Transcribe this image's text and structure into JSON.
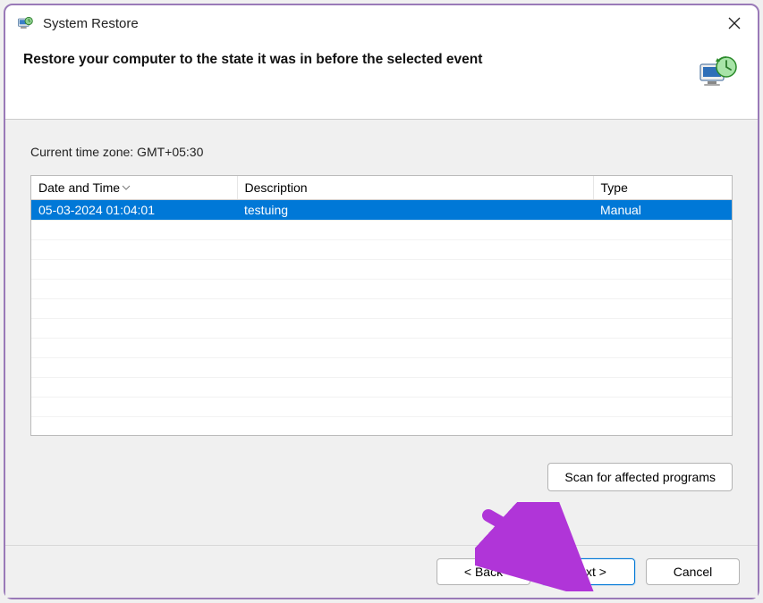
{
  "window": {
    "title": "System Restore"
  },
  "header": {
    "heading": "Restore your computer to the state it was in before the selected event"
  },
  "content": {
    "timezone_label": "Current time zone: GMT+05:30"
  },
  "table": {
    "columns": {
      "datetime": "Date and Time",
      "description": "Description",
      "type": "Type"
    },
    "rows": [
      {
        "datetime": "05-03-2024 01:04:01",
        "description": "testuing",
        "type": "Manual",
        "selected": true
      }
    ]
  },
  "buttons": {
    "scan": "Scan for affected programs",
    "back": "< Back",
    "next": "Next >",
    "cancel": "Cancel"
  }
}
